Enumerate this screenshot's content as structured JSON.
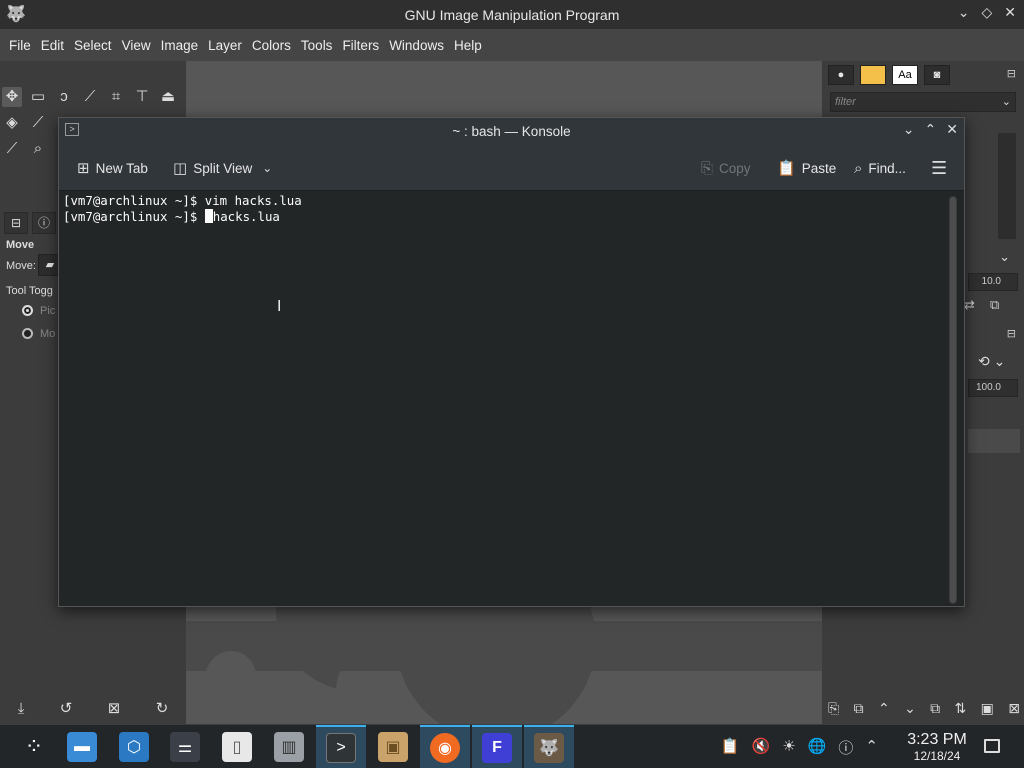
{
  "gimp": {
    "title": "GNU Image Manipulation Program",
    "menu": [
      "File",
      "Edit",
      "Select",
      "View",
      "Image",
      "Layer",
      "Colors",
      "Tools",
      "Filters",
      "Windows",
      "Help"
    ],
    "tool_options": {
      "heading": "Move",
      "move_label": "Move:",
      "toggle_label": "Tool Togg",
      "radio1": "Pic",
      "radio2": "Mo"
    },
    "right_panel": {
      "filter_placeholder": "filter",
      "spacing_value": "10.0",
      "opacity_value": "100.0",
      "font_tab_label": "Aa"
    }
  },
  "konsole": {
    "title": "~ : bash — Konsole",
    "toolbar": {
      "new_tab": "New Tab",
      "split_view": "Split View",
      "copy": "Copy",
      "paste": "Paste",
      "find": "Find..."
    },
    "terminal_lines": [
      "[vm7@archlinux ~]$ vim hacks.lua",
      "[vm7@archlinux ~]$ "
    ],
    "after_cursor": "hacks.lua"
  },
  "taskbar": {
    "apps": [
      "application-launcher",
      "file-manager",
      "discover",
      "system-settings",
      "text-editor",
      "archive-manager",
      "konsole",
      "package-manager",
      "firefox",
      "freetube",
      "gimp"
    ],
    "time": "3:23 PM",
    "date": "12/18/24"
  },
  "colors": {
    "accent": "#3daee9",
    "terminal_bg": "#232627",
    "gimp_bg": "#454545"
  }
}
